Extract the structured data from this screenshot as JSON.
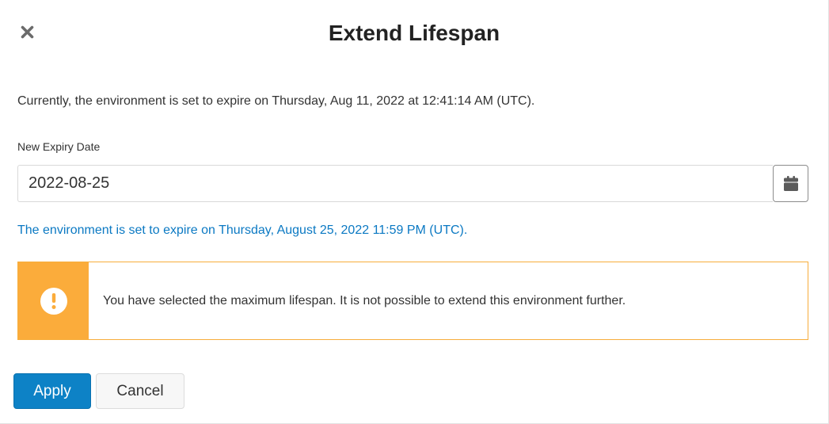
{
  "dialog": {
    "title": "Extend Lifespan",
    "close_icon": "close-icon"
  },
  "current_expiry_text": "Currently, the environment is set to expire on Thursday, Aug 11, 2022 at 12:41:14 AM (UTC).",
  "expiry_field": {
    "label": "New Expiry Date",
    "value": "2022-08-25",
    "calendar_icon": "calendar-icon"
  },
  "new_expiry_text": "The environment is set to expire on Thursday, August 25, 2022 11:59 PM (UTC).",
  "alert": {
    "icon": "exclamation-circle-icon",
    "message": "You have selected the maximum lifespan. It is not possible to extend this environment further."
  },
  "buttons": {
    "apply_label": "Apply",
    "cancel_label": "Cancel"
  },
  "colors": {
    "primary": "#0d82c6",
    "info_text": "#0b79c3",
    "warning": "#fbac3b"
  }
}
